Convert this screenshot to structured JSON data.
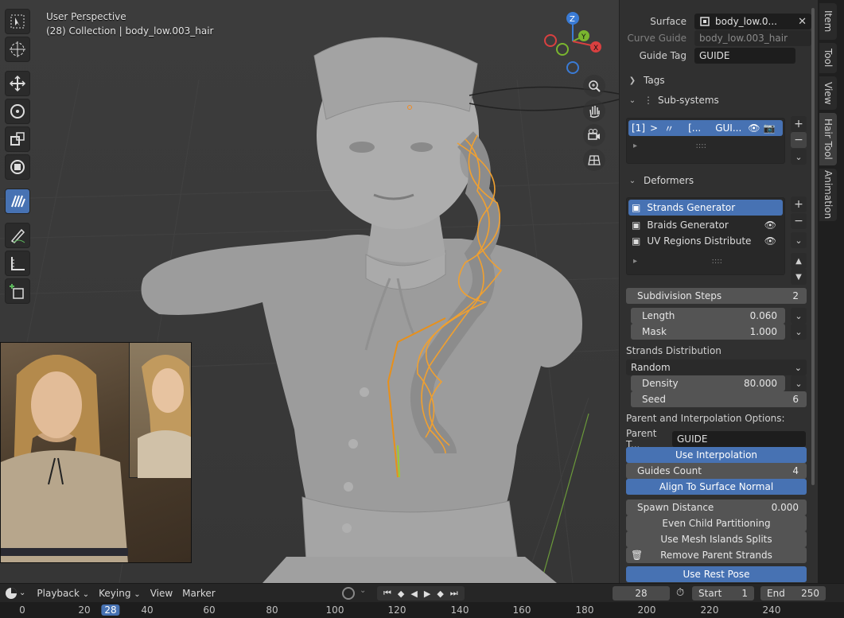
{
  "viewport": {
    "perspective_label": "User Perspective",
    "collection_label": "(28) Collection | body_low.003_hair",
    "gizmo_axes": {
      "z": "Z",
      "y": "Y",
      "x": "X"
    }
  },
  "toolbar": {
    "tools": [
      "select-box-icon",
      "cursor-icon",
      "move-icon",
      "rotate-icon",
      "scale-icon",
      "transform-icon",
      "hair-comb-icon",
      "annotate-icon",
      "measure-icon",
      "add-cube-icon"
    ]
  },
  "properties": {
    "surface_label": "Surface",
    "surface_value": "body_low.0...",
    "curve_guide_label": "Curve Guide",
    "curve_guide_value": "body_low.003_hair",
    "guide_tag_label": "Guide Tag",
    "guide_tag_value": "GUIDE",
    "tags_label": "Tags",
    "subsystems_label": "Sub-systems",
    "subsystem_item": {
      "index": "[1]",
      "arrow": ">",
      "col2": "[...",
      "col3": "GUI..."
    },
    "deformers_label": "Deformers",
    "deformers": [
      {
        "label": "Strands Generator",
        "selected": true
      },
      {
        "label": "Braids Generator",
        "selected": false
      },
      {
        "label": "UV Regions Distribute",
        "selected": false
      }
    ],
    "subdivision_steps_label": "Subdivision Steps",
    "subdivision_steps_value": "2",
    "length_label": "Length",
    "length_value": "0.060",
    "mask_label": "Mask",
    "mask_value": "1.000",
    "strands_distribution_label": "Strands Distribution",
    "distribution_mode": "Random",
    "density_label": "Density",
    "density_value": "80.000",
    "seed_label": "Seed",
    "seed_value": "6",
    "parent_interp_label": "Parent and Interpolation Options:",
    "parent_tag_label": "Parent T...",
    "parent_tag_value": "GUIDE",
    "use_interpolation_label": "Use Interpolation",
    "guides_count_label": "Guides Count",
    "guides_count_value": "4",
    "align_surface_normal_label": "Align To Surface Normal",
    "spawn_distance_label": "Spawn Distance",
    "spawn_distance_value": "0.000",
    "even_child_label": "Even Child Partitioning",
    "mesh_islands_label": "Use Mesh Islands Splits",
    "remove_parent_label": "Remove Parent Strands",
    "use_rest_pose_label": "Use Rest Pose"
  },
  "vtabs": [
    "Item",
    "Tool",
    "View",
    "Hair Tool",
    "Animation"
  ],
  "timeline": {
    "playback_label": "Playback",
    "keying_label": "Keying",
    "view_label": "View",
    "marker_label": "Marker",
    "current_frame": "28",
    "start_label": "Start",
    "start_value": "1",
    "end_label": "End",
    "end_value": "250",
    "ruler_ticks": [
      "0",
      "20",
      "28",
      "40",
      "60",
      "80",
      "100",
      "120",
      "140",
      "160",
      "180",
      "200",
      "220",
      "240"
    ]
  },
  "colors": {
    "accent": "#4772b3",
    "selection_orange": "#f0a030"
  }
}
